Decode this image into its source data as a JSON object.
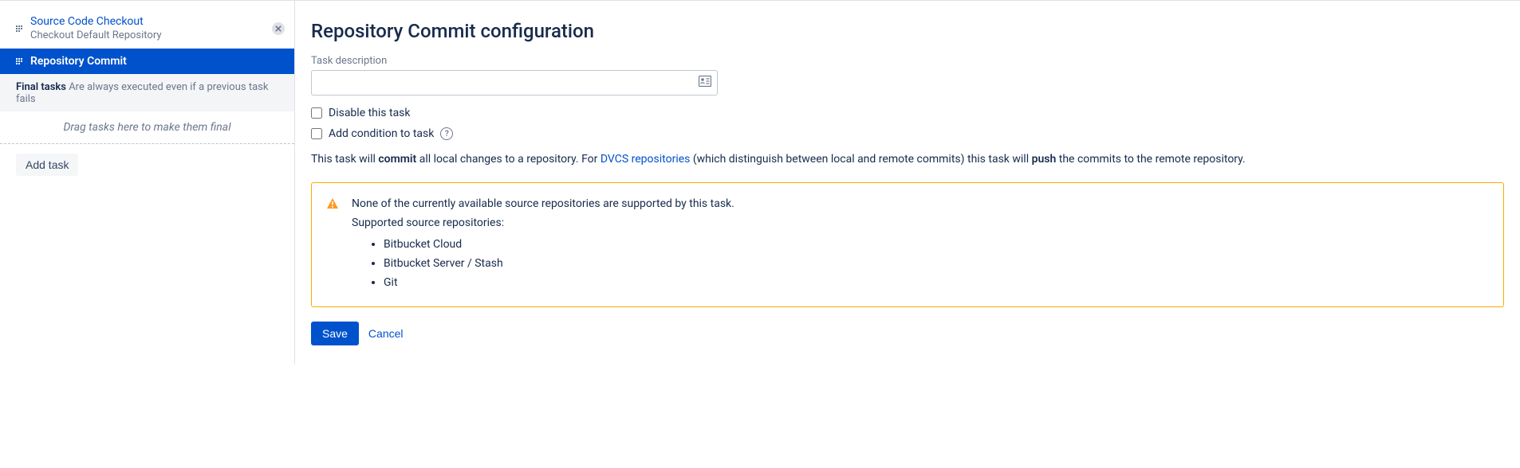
{
  "sidebar": {
    "tasks": [
      {
        "title": "Source Code Checkout",
        "subtitle": "Checkout Default Repository"
      },
      {
        "title": "Repository Commit"
      }
    ],
    "final_label_bold": "Final tasks",
    "final_label_light": "Are always executed even if a previous task fails",
    "drop_zone": "Drag tasks here to make them final",
    "add_task": "Add task"
  },
  "main": {
    "heading": "Repository Commit configuration",
    "desc_label": "Task description",
    "disable_label": "Disable this task",
    "condition_label": "Add condition to task",
    "task_text_1": "This task will ",
    "task_text_bold1": "commit",
    "task_text_2": " all local changes to a repository. For ",
    "task_text_link": "DVCS repositories",
    "task_text_3": " (which distinguish between local and remote commits) this task will ",
    "task_text_bold2": "push",
    "task_text_4": " the commits to the remote repository.",
    "warning": {
      "line1": "None of the currently available source repositories are supported by this task.",
      "line2": "Supported source repositories:",
      "items": [
        "Bitbucket Cloud",
        "Bitbucket Server / Stash",
        "Git"
      ]
    },
    "save": "Save",
    "cancel": "Cancel"
  }
}
